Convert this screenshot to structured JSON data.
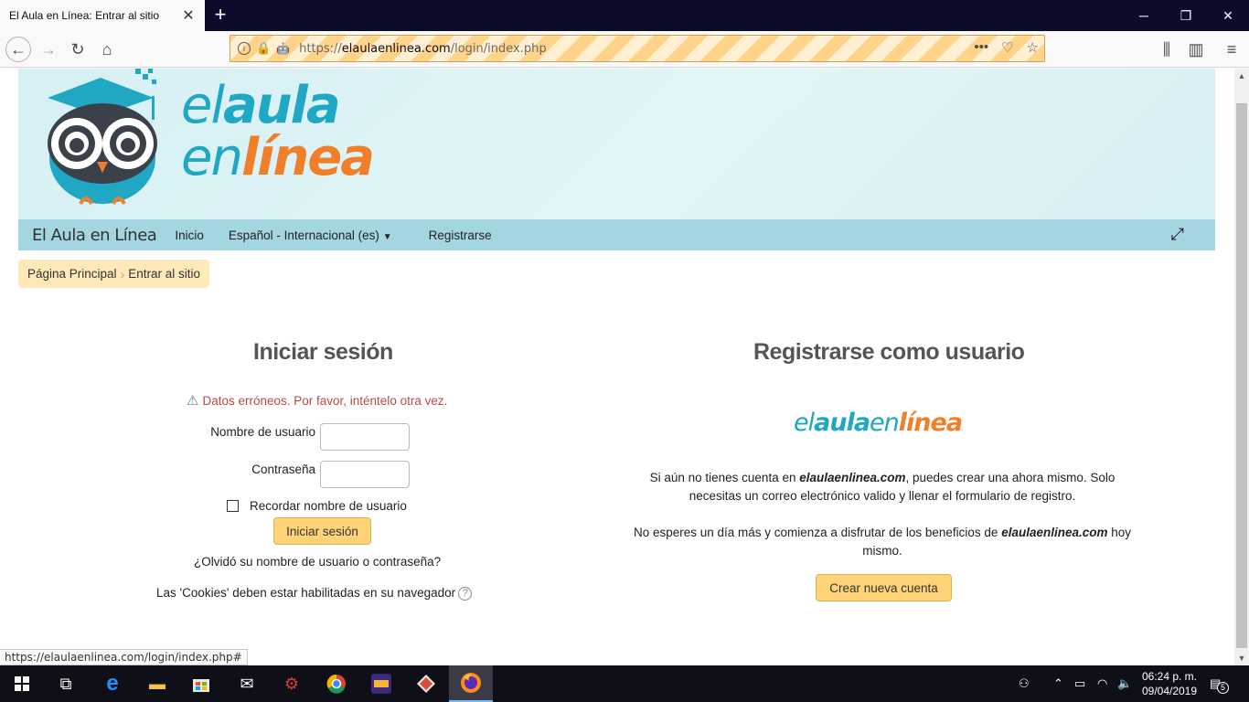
{
  "browser": {
    "tab_title": "El Aula en Línea: Entrar al sitio",
    "url_scheme": "https://",
    "url_domain": "elaulaenlinea.com",
    "url_path": "/login/index.php"
  },
  "header": {
    "logo_line1_light": "el",
    "logo_line1_bold": "aula",
    "logo_line2_light": "en",
    "logo_line2_bold": "línea"
  },
  "menu": {
    "brand": "El Aula en Línea",
    "items": [
      "Inicio",
      "Español - Internacional (es)",
      "Registrarse"
    ]
  },
  "breadcrumb": {
    "items": [
      "Página Principal",
      "Entrar al sitio"
    ]
  },
  "login": {
    "title": "Iniciar sesión",
    "error": "Datos erróneos. Por favor, inténtelo otra vez.",
    "username_label": "Nombre de usuario",
    "password_label": "Contraseña",
    "remember_label": "Recordar nombre de usuario",
    "submit_label": "Iniciar sesión",
    "forgot_label": "¿Olvidó su nombre de usuario o contraseña?",
    "cookies_label": "Las 'Cookies' deben estar habilitadas en su navegador"
  },
  "signup": {
    "title": "Registrarse como usuario",
    "logo_parts": [
      "el",
      "aula",
      "en",
      "línea"
    ],
    "para1_a": "Si aún no tienes cuenta en ",
    "para1_site": "elaulaenlinea.com",
    "para1_b": ", puedes crear una ahora mismo.  Solo necesitas un correo electrónico valido y llenar el formulario de registro.",
    "para2_a": "No esperes un día más y comienza  a disfrutar de los beneficios de ",
    "para2_site": "elaulaenlinea.com",
    "para2_b": " hoy mismo.",
    "button_label": "Crear nueva cuenta"
  },
  "status_bar": "https://elaulaenlinea.com/login/index.php#",
  "taskbar": {
    "time": "06:24 p. m.",
    "date": "09/04/2019",
    "notification_count": "5"
  },
  "colors": {
    "teal": "#1fa7c4",
    "orange": "#f07f2a",
    "menu_bg": "#a3d6e0",
    "button_bg": "#ffd478",
    "error": "#b94a48"
  }
}
